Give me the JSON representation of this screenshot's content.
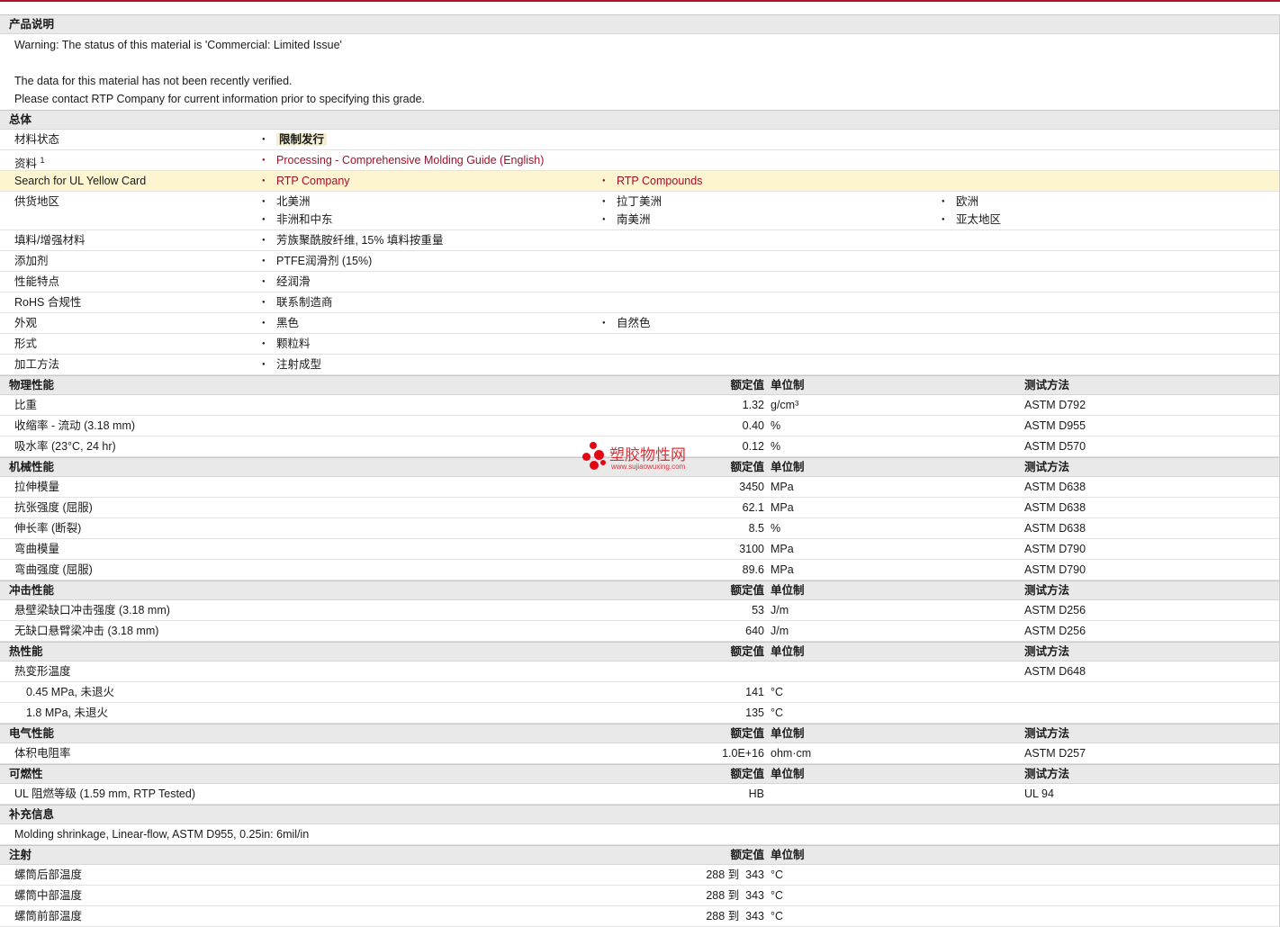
{
  "sections": {
    "desc": {
      "title": "产品说明",
      "lines": [
        "Warning: The status of this material is 'Commercial: Limited Issue'",
        "",
        "The data for this material has not been recently verified.",
        "Please contact RTP Company for current information prior to specifying this grade."
      ]
    },
    "general": {
      "title": "总体",
      "status_label": "材料状态",
      "status_value": "限制发行",
      "resources_label": "资料",
      "resources_sup": "1",
      "resources_link": "Processing - Comprehensive Molding Guide (English)",
      "ul_label": "Search for UL Yellow Card",
      "ul_link1": "RTP Company",
      "ul_link2": "RTP Compounds",
      "availability_label": "供货地区",
      "availability": [
        "北美洲",
        "拉丁美洲",
        "欧洲",
        "非洲和中东",
        "南美洲",
        "亚太地区"
      ],
      "filler_label": "填料/增强材料",
      "filler_value": "芳族聚酰胺纤维, 15% 填料按重量",
      "additive_label": "添加剂",
      "additive_value": "PTFE润滑剂 (15%)",
      "features_label": "性能特点",
      "features_value": "经润滑",
      "rohs_label": "RoHS 合规性",
      "rohs_value": "联系制造商",
      "appearance_label": "外观",
      "appearance": [
        "黑色",
        "自然色"
      ],
      "forms_label": "形式",
      "forms_value": "颗粒料",
      "method_label": "加工方法",
      "method_value": "注射成型"
    },
    "headers": {
      "nominal": "额定值",
      "unit": "单位制",
      "test": "测试方法"
    },
    "physical": {
      "title": "物理性能",
      "rows": [
        {
          "label": "比重",
          "value": "1.32",
          "unit": "g/cm³",
          "method": "ASTM D792"
        },
        {
          "label": "收缩率 - 流动 (3.18 mm)",
          "value": "0.40",
          "unit": "%",
          "method": "ASTM D955"
        },
        {
          "label": "吸水率 (23°C, 24 hr)",
          "value": "0.12",
          "unit": "%",
          "method": "ASTM D570"
        }
      ]
    },
    "mechanical": {
      "title": "机械性能",
      "rows": [
        {
          "label": "拉伸模量",
          "value": "3450",
          "unit": "MPa",
          "method": "ASTM D638"
        },
        {
          "label": "抗张强度 (屈服)",
          "value": "62.1",
          "unit": "MPa",
          "method": "ASTM D638"
        },
        {
          "label": "伸长率 (断裂)",
          "value": "8.5",
          "unit": "%",
          "method": "ASTM D638"
        },
        {
          "label": "弯曲模量",
          "value": "3100",
          "unit": "MPa",
          "method": "ASTM D790"
        },
        {
          "label": "弯曲强度 (屈服)",
          "value": "89.6",
          "unit": "MPa",
          "method": "ASTM D790"
        }
      ]
    },
    "impact": {
      "title": "冲击性能",
      "rows": [
        {
          "label": "悬壁梁缺口冲击强度 (3.18 mm)",
          "value": "53",
          "unit": "J/m",
          "method": "ASTM D256"
        },
        {
          "label": "无缺口悬臂梁冲击 (3.18 mm)",
          "value": "640",
          "unit": "J/m",
          "method": "ASTM D256"
        }
      ]
    },
    "thermal": {
      "title": "热性能",
      "hdt_label": "热变形温度",
      "hdt_method": "ASTM D648",
      "rows": [
        {
          "label": "0.45 MPa, 未退火",
          "value": "141",
          "unit": "°C"
        },
        {
          "label": "1.8 MPa, 未退火",
          "value": "135",
          "unit": "°C"
        }
      ]
    },
    "electrical": {
      "title": "电气性能",
      "rows": [
        {
          "label": "体积电阻率",
          "value": "1.0E+16",
          "unit": "ohm·cm",
          "method": "ASTM D257"
        }
      ]
    },
    "flammability": {
      "title": "可燃性",
      "rows": [
        {
          "label": "UL 阻燃等级 (1.59 mm, RTP Tested)",
          "value": "HB",
          "unit": "",
          "method": "UL 94"
        }
      ]
    },
    "additional": {
      "title": "补充信息",
      "text": "Molding shrinkage, Linear-flow, ASTM D955, 0.25in: 6mil/in"
    },
    "injection": {
      "title": "注射",
      "rows": [
        {
          "label": "螺筒后部温度",
          "value": "288 到  343",
          "unit": "°C"
        },
        {
          "label": "螺筒中部温度",
          "value": "288 到  343",
          "unit": "°C"
        },
        {
          "label": "螺筒前部温度",
          "value": "288 到  343",
          "unit": "°C"
        }
      ]
    }
  },
  "watermark": {
    "text": "塑胶物性网",
    "url": "www.sujiaowuxing.com"
  },
  "colors": {
    "link": "#a0102a",
    "section_bg": "#e9e9e9",
    "highlight_row": "#fcf5cf"
  }
}
